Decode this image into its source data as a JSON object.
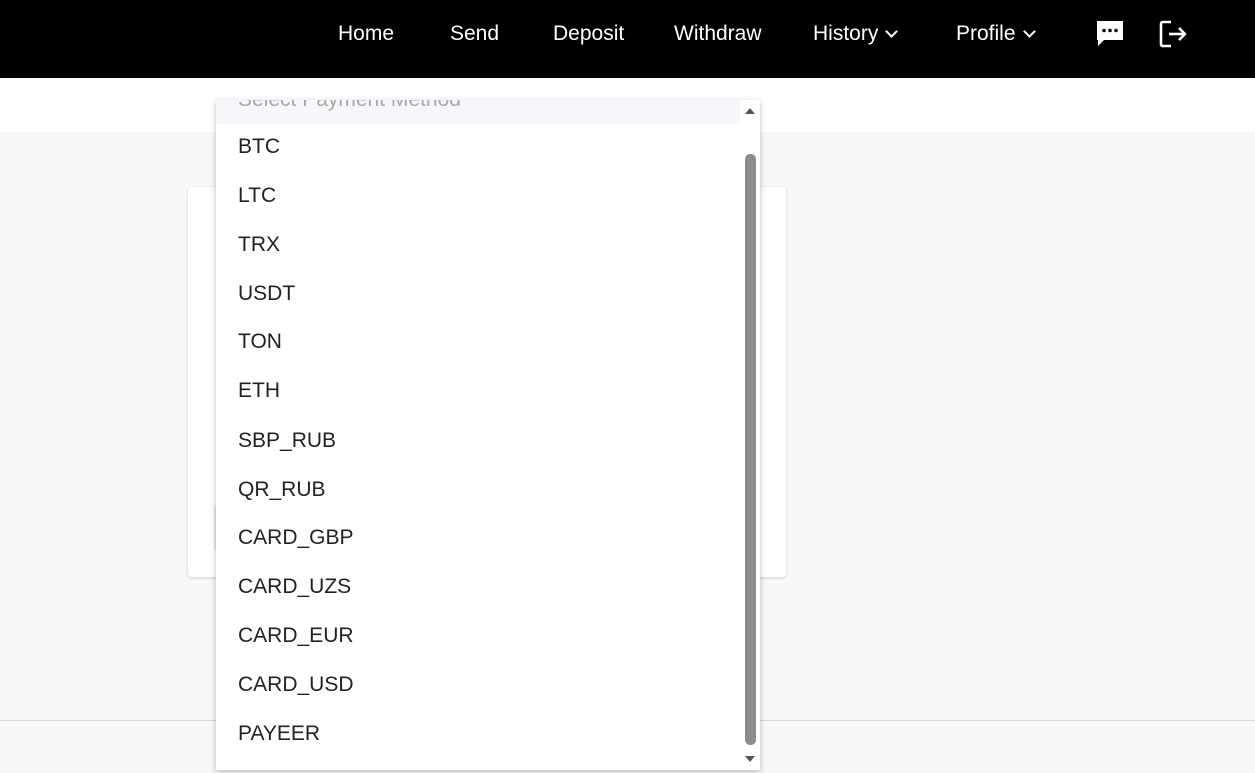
{
  "nav": {
    "home": "Home",
    "send": "Send",
    "deposit": "Deposit",
    "withdraw": "Withdraw",
    "history": "History",
    "profile": "Profile",
    "chat_icon": "chat-bubble-icon",
    "logout_icon": "logout-icon"
  },
  "dropdown": {
    "placeholder": "Select Payment Method",
    "options": [
      "BTC",
      "LTC",
      "TRX",
      "USDT",
      "TON",
      "ETH",
      "SBP_RUB",
      "QR_RUB",
      "CARD_GBP",
      "CARD_UZS",
      "CARD_EUR",
      "CARD_USD",
      "PAYEER"
    ]
  },
  "colors": {
    "navbar_bg": "#000000",
    "page_bg": "#f8f8f8",
    "scroll_thumb": "#8c8c8c"
  }
}
